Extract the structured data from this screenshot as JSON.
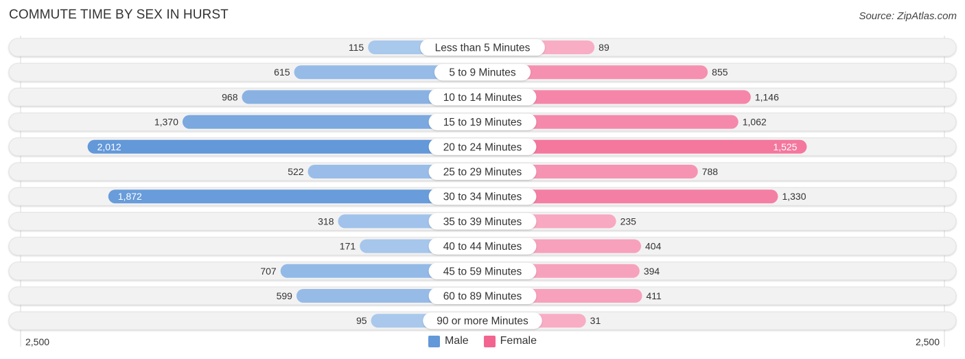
{
  "title": "COMMUTE TIME BY SEX IN HURST",
  "source": "Source: ZipAtlas.com",
  "colors": {
    "male": "#6398d9",
    "male_light": "#a9c8ec",
    "female": "#f26591",
    "female_light": "#f8adc5",
    "track": "#f2f2f2",
    "label_bg": "#ffffff"
  },
  "legend": [
    {
      "label": "Male",
      "color": "#6398d9"
    },
    {
      "label": "Female",
      "color": "#f26591"
    }
  ],
  "axis": {
    "left_label": "2,500",
    "right_label": "2,500"
  },
  "chart_data": {
    "type": "bar",
    "orientation": "horizontal-diverging",
    "title": "COMMUTE TIME BY SEX IN HURST",
    "xlabel": "",
    "ylabel": "",
    "xlim": [
      0,
      2500
    ],
    "legend_position": "bottom-center",
    "grid": false,
    "categories": [
      "Less than 5 Minutes",
      "5 to 9 Minutes",
      "10 to 14 Minutes",
      "15 to 19 Minutes",
      "20 to 24 Minutes",
      "25 to 29 Minutes",
      "30 to 34 Minutes",
      "35 to 39 Minutes",
      "40 to 44 Minutes",
      "45 to 59 Minutes",
      "60 to 89 Minutes",
      "90 or more Minutes"
    ],
    "series": [
      {
        "name": "Male",
        "side": "left",
        "values": [
          115,
          615,
          968,
          1370,
          2012,
          522,
          1872,
          318,
          171,
          707,
          599,
          95
        ],
        "labels": [
          "115",
          "615",
          "968",
          "1,370",
          "2,012",
          "522",
          "1,872",
          "318",
          "171",
          "707",
          "599",
          "95"
        ]
      },
      {
        "name": "Female",
        "side": "right",
        "values": [
          89,
          855,
          1146,
          1062,
          1525,
          788,
          1330,
          235,
          404,
          394,
          411,
          31
        ],
        "labels": [
          "89",
          "855",
          "1,146",
          "1,062",
          "1,525",
          "788",
          "1,330",
          "235",
          "404",
          "394",
          "411",
          "31"
        ]
      }
    ]
  }
}
